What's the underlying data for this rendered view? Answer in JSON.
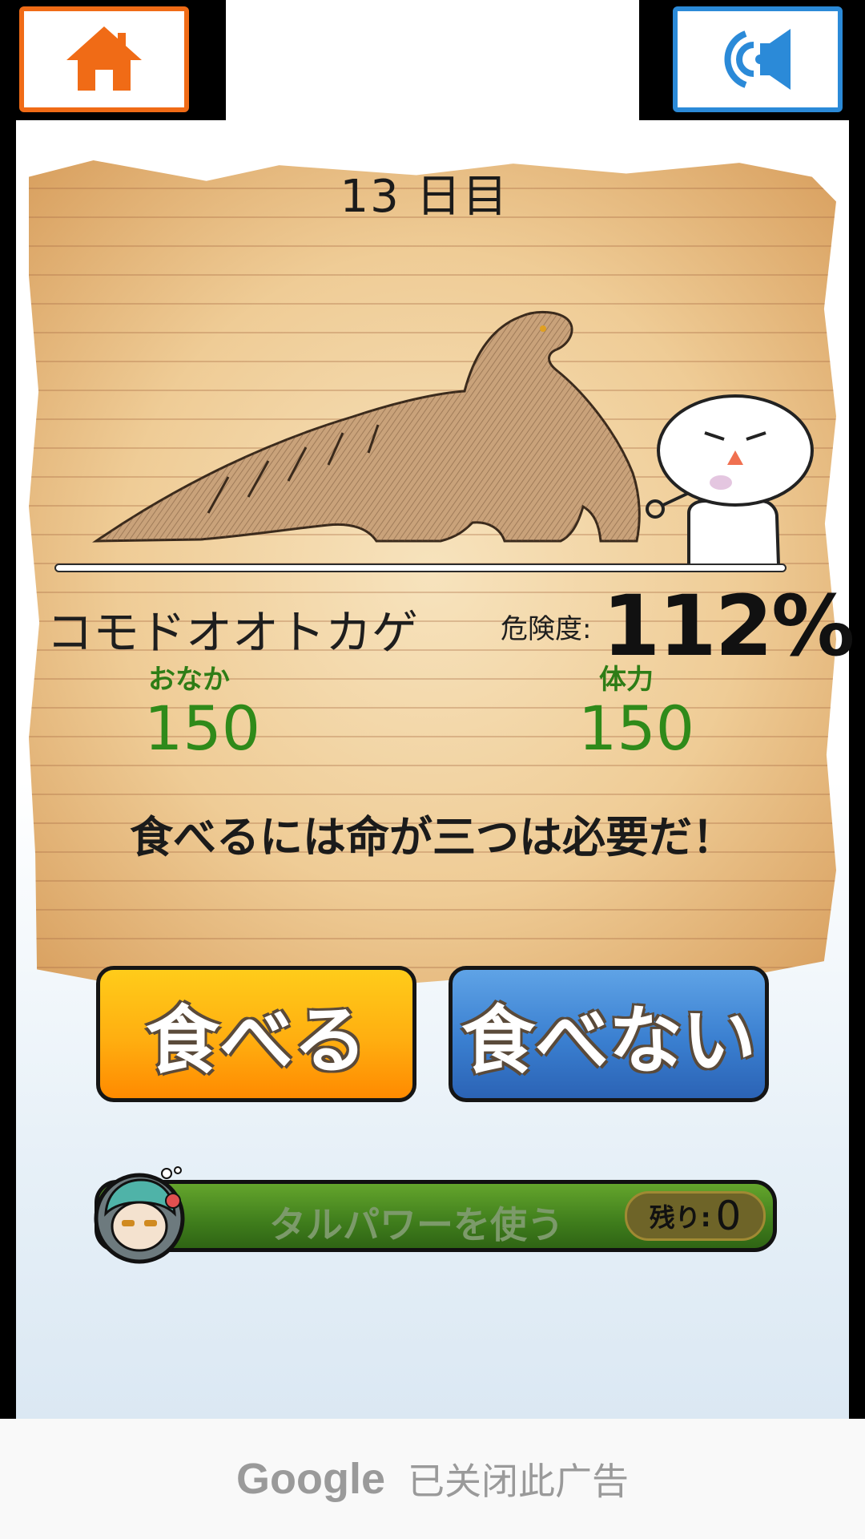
{
  "header": {
    "home_icon": "home-icon",
    "sound_icon": "speaker-icon"
  },
  "game": {
    "day": "13 日目",
    "animal_name": "コモドオオトカゲ",
    "danger_label": "危険度:",
    "danger_value": "112%",
    "hunger_label": "おなか",
    "hunger_value": "150",
    "stamina_label": "体力",
    "stamina_value": "150",
    "message": "食べるには命が三つは必要だ！",
    "eat_label": "食べる",
    "dont_eat_label": "食べない",
    "power_label": "タルパワーを使う",
    "remaining_label": "残り:",
    "remaining_value": "0"
  },
  "ad": {
    "logo": "Google",
    "text": "已关闭此广告"
  },
  "colors": {
    "home_border": "#f06b16",
    "sound_border": "#2b8ad8",
    "eat_button": "#ffae10",
    "dont_eat_button": "#3a7fd0",
    "stat_green": "#2f8a1a"
  }
}
